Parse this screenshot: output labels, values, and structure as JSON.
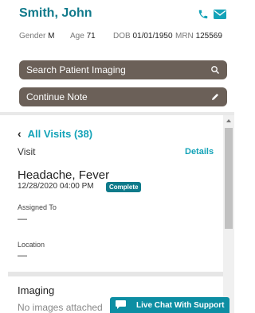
{
  "patient": {
    "name": "Smith, John",
    "gender_label": "Gender",
    "gender": "M",
    "age_label": "Age",
    "age": "71",
    "dob_label": "DOB",
    "dob": "01/01/1950",
    "mrn_label": "MRN",
    "mrn": "125569"
  },
  "actions": {
    "search_imaging": "Search Patient Imaging",
    "continue_note": "Continue Note"
  },
  "visits": {
    "back_label": "All Visits (38)",
    "visit_header": "Visit",
    "details_label": "Details",
    "reason": "Headache, Fever",
    "datetime": "12/28/2020 04:00 PM",
    "status": "Complete",
    "assigned_label": "Assigned To",
    "assigned_value": "—",
    "location_label": "Location",
    "location_value": "—"
  },
  "imaging": {
    "title": "Imaging",
    "empty_text": "No images attached"
  },
  "chat": {
    "label": "Live Chat With Support"
  },
  "colors": {
    "accent_teal": "#14a3b8",
    "button_brown": "#6b6058",
    "badge_teal": "#0f7a8a",
    "chat_teal": "#0d8ea3"
  }
}
